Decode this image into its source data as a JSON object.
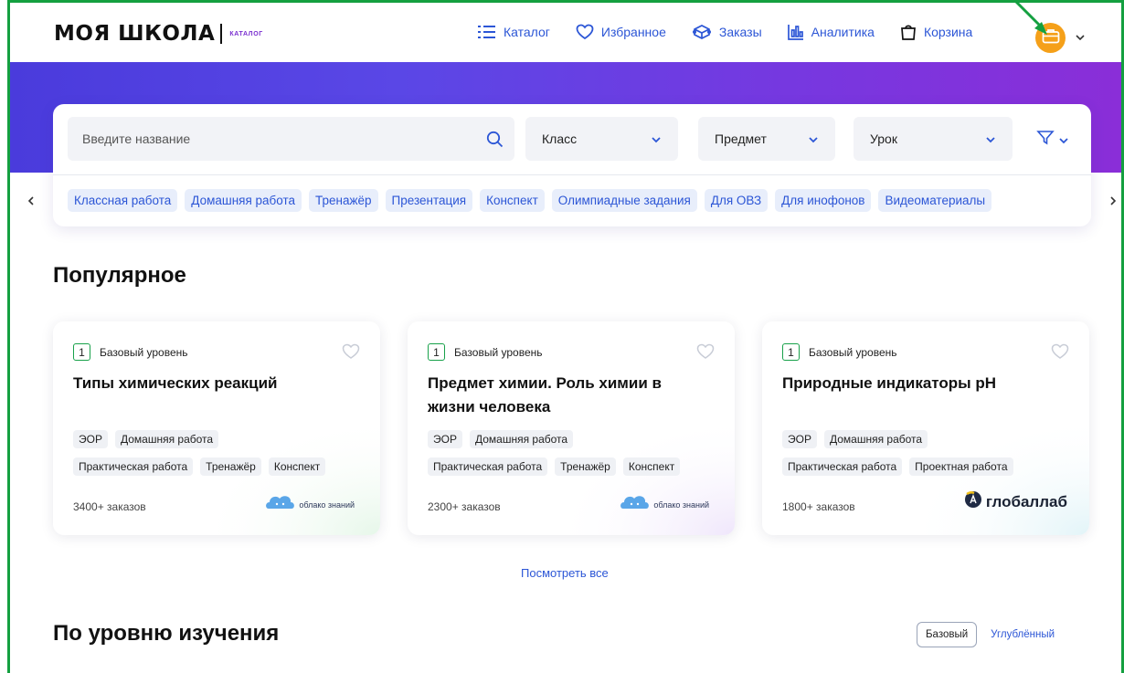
{
  "header": {
    "logo_main": "МОЯ ШКОЛА",
    "logo_sub": "КАТАЛОГ",
    "nav": [
      {
        "label": "Каталог",
        "icon": "list-icon"
      },
      {
        "label": "Избранное",
        "icon": "heart-icon"
      },
      {
        "label": "Заказы",
        "icon": "orders-icon"
      },
      {
        "label": "Аналитика",
        "icon": "analytics-icon"
      },
      {
        "label": "Корзина",
        "icon": "bag-icon"
      }
    ],
    "avatar_icon": "briefcase-icon"
  },
  "search": {
    "placeholder": "Введите название",
    "selects": [
      {
        "label": "Класс"
      },
      {
        "label": "Предмет"
      },
      {
        "label": "Урок"
      }
    ]
  },
  "chips": [
    "Классная работа",
    "Домашняя работа",
    "Тренажёр",
    "Презентация",
    "Конспект",
    "Олимпиадные задания",
    "Для ОВЗ",
    "Для инофонов",
    "Видеоматериалы"
  ],
  "popular": {
    "title": "Популярное",
    "cards": [
      {
        "level_num": "1",
        "level_label": "Базовый уровень",
        "title": "Типы химических реакций",
        "tag_rows": [
          [
            "ЭОР",
            "Домашняя работа"
          ],
          [
            "Практическая работа",
            "Тренажёр",
            "Конспект"
          ]
        ],
        "orders": "3400+ заказов",
        "brand": "облако знаний"
      },
      {
        "level_num": "1",
        "level_label": "Базовый уровень",
        "title": "Предмет химии. Роль химии в жизни человека",
        "tag_rows": [
          [
            "ЭОР",
            "Домашняя работа"
          ],
          [
            "Практическая работа",
            "Тренажёр",
            "Конспект"
          ]
        ],
        "orders": "2300+ заказов",
        "brand": "облако знаний"
      },
      {
        "level_num": "1",
        "level_label": "Базовый уровень",
        "title": "Природные индикаторы pH",
        "tag_rows": [
          [
            "ЭОР",
            "Домашняя работа"
          ],
          [
            "Практическая работа",
            "Проектная работа"
          ]
        ],
        "orders": "1800+ заказов",
        "brand": "глобаллаб"
      }
    ],
    "see_all": "Посмотреть все"
  },
  "by_level": {
    "title": "По уровню изучения",
    "options": [
      "Базовый",
      "Углублённый"
    ],
    "selected": "Базовый"
  },
  "colors": {
    "accent": "#2c56d6",
    "hero_start": "#4a3bdc",
    "hero_end": "#8a2ed8",
    "avatar": "#f5a019",
    "highlight_frame": "#14a040"
  }
}
